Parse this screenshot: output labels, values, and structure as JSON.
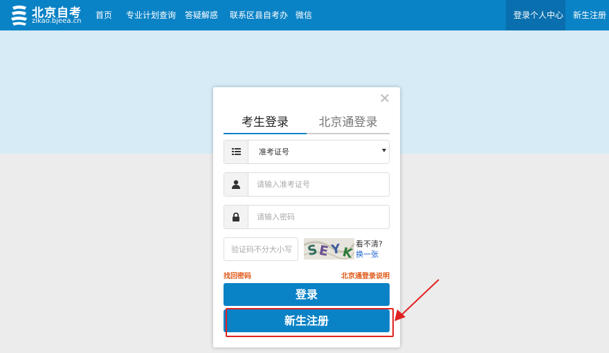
{
  "header": {
    "logo_title": "北京自考",
    "logo_subtitle": "zikao.bjeea.cn",
    "nav": [
      "首页",
      "专业计划查询",
      "答疑解惑",
      "联系区县自考办",
      "微信"
    ],
    "login_center": "登录个人中心",
    "register": "新生注册"
  },
  "modal": {
    "close_symbol": "✕",
    "tabs": [
      {
        "label": "考生登录",
        "active": true
      },
      {
        "label": "北京通登录",
        "active": false
      }
    ],
    "id_type": {
      "selected": "准考证号",
      "icon": "list-icon"
    },
    "username": {
      "placeholder": "请输入准考证号",
      "icon": "user-icon"
    },
    "password": {
      "placeholder": "请输入密码",
      "icon": "lock-icon"
    },
    "captcha": {
      "placeholder": "验证码不分大小写",
      "image_text": "SEYK",
      "question": "看不清?",
      "refresh": "换一张"
    },
    "forgot_password": "找回密码",
    "bjt_help": "北京通登录说明",
    "login_button": "登录",
    "register_button": "新生注册"
  },
  "colors": {
    "primary": "#0a82c6",
    "nav_active": "#0a6fae",
    "band": "#d6ebf6",
    "link_orange": "#e05a1a",
    "annotation_red": "#e02020"
  }
}
